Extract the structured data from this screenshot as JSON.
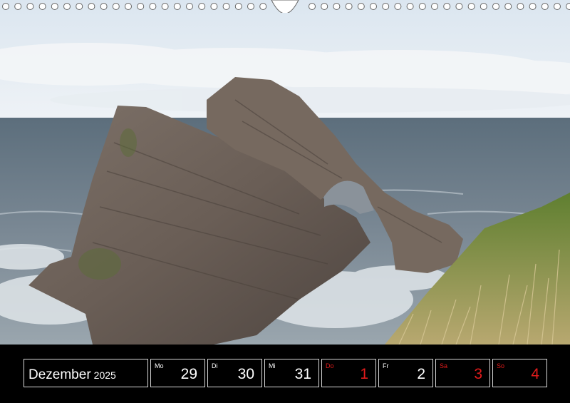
{
  "calendar": {
    "month": "Dezember",
    "year": "2025",
    "days": [
      {
        "weekday": "Mo",
        "day": "29",
        "red": false
      },
      {
        "weekday": "Di",
        "day": "30",
        "red": false
      },
      {
        "weekday": "Mi",
        "day": "31",
        "red": false
      },
      {
        "weekday": "Do",
        "day": "1",
        "red": true
      },
      {
        "weekday": "Fr",
        "day": "2",
        "red": false
      },
      {
        "weekday": "Sa",
        "day": "3",
        "red": true
      },
      {
        "weekday": "So",
        "day": "4",
        "red": true
      }
    ]
  },
  "colors": {
    "sky_top": "#e4edf5",
    "sea": "#6f7f8c",
    "rock": "#6e6259",
    "grass": "#5b7a2e",
    "holiday": "#e01b1b",
    "strip": "#000000"
  }
}
